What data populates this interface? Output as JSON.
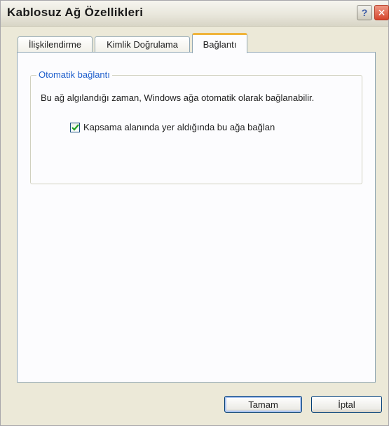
{
  "window": {
    "title": "Kablosuz Ağ Özellikleri",
    "help_icon": "question-mark-icon",
    "close_icon": "close-x-icon"
  },
  "tabs": [
    {
      "label": "İlişkilendirme",
      "active": false
    },
    {
      "label": "Kimlik Doğrulama",
      "active": false
    },
    {
      "label": "Bağlantı",
      "active": true
    }
  ],
  "group": {
    "title": "Otomatik bağlantı",
    "description": "Bu ağ algılandığı zaman, Windows ağa otomatik olarak bağlanabilir.",
    "checkbox": {
      "label": "Kapsama alanında yer aldığında bu ağa bağlan",
      "checked": true
    }
  },
  "buttons": {
    "ok": "Tamam",
    "cancel": "İptal"
  },
  "colors": {
    "legend": "#1f5fcc",
    "tab_highlight": "#f0b43c",
    "checkmark": "#21a121",
    "dialog_bg": "#ece9d8"
  }
}
